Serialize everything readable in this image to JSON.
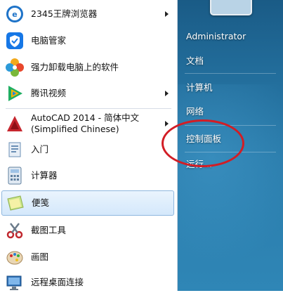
{
  "programs": [
    {
      "label": "2345王牌浏览器",
      "icon": "browser-2345-icon",
      "has_arrow": true
    },
    {
      "label": "电脑管家",
      "icon": "shield-icon",
      "has_arrow": false
    },
    {
      "label": "强力卸载电脑上的软件",
      "icon": "flower-uninstall-icon",
      "has_arrow": false
    },
    {
      "label": "腾讯视频",
      "icon": "video-play-icon",
      "has_arrow": true
    },
    {
      "label": "AutoCAD 2014 - 简体中文",
      "label2": "(Simplified Chinese)",
      "icon": "autocad-icon",
      "has_arrow": true
    },
    {
      "label": "入门",
      "icon": "getting-started-icon",
      "has_arrow": false
    },
    {
      "label": "计算器",
      "icon": "calculator-icon",
      "has_arrow": false
    },
    {
      "label": "便笺",
      "icon": "sticky-notes-icon",
      "has_arrow": false,
      "selected": true
    },
    {
      "label": "截图工具",
      "icon": "snipping-tool-icon",
      "has_arrow": false
    },
    {
      "label": "画图",
      "icon": "paint-palette-icon",
      "has_arrow": false
    },
    {
      "label": "远程桌面连接",
      "icon": "remote-desktop-icon",
      "has_arrow": false
    }
  ],
  "right_pane": {
    "user": "Administrator",
    "documents": "文档",
    "computer": "计算机",
    "network": "网络",
    "control_panel": "控制面板",
    "run": "运行..."
  },
  "colors": {
    "right_pane_bg": "#2270a0",
    "highlight_border": "#8fb7de",
    "annotation_circle": "#d21d25"
  }
}
